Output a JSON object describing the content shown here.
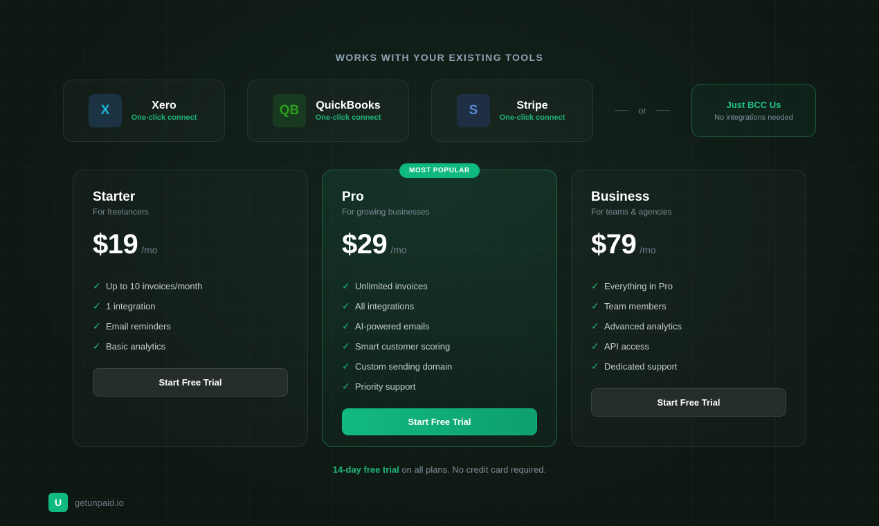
{
  "heading": "WORKS WITH YOUR EXISTING TOOLS",
  "integrations": [
    {
      "name": "Xero",
      "subtitle": "One-click connect",
      "logo_text": "X",
      "icon": "xero-logo-icon",
      "color": "#1ab4d7",
      "bg": "#1b3342"
    },
    {
      "name": "QuickBooks",
      "subtitle": "One-click connect",
      "logo_text": "QB",
      "icon": "quickbooks-logo-icon",
      "color": "#2ca01c",
      "bg": "#173a20"
    },
    {
      "name": "Stripe",
      "subtitle": "One-click connect",
      "logo_text": "S",
      "icon": "stripe-logo-icon",
      "color": "#5a86d6",
      "bg": "#1f2f43"
    }
  ],
  "or_label": "or",
  "bcc": {
    "title": "Just BCC Us",
    "subtitle": "No integrations needed"
  },
  "plans": [
    {
      "name": "Starter",
      "description": "For freelancers",
      "price": "$19",
      "period": "/mo",
      "features": [
        "Up to 10 invoices/month",
        "1 integration",
        "Email reminders",
        "Basic analytics"
      ],
      "cta": "Start Free Trial"
    },
    {
      "name": "Pro",
      "description": "For growing businesses",
      "price": "$29",
      "period": "/mo",
      "badge": "MOST POPULAR",
      "features": [
        "Unlimited invoices",
        "All integrations",
        "AI-powered emails",
        "Smart customer scoring",
        "Custom sending domain",
        "Priority support"
      ],
      "cta": "Start Free Trial"
    },
    {
      "name": "Business",
      "description": "For teams & agencies",
      "price": "$79",
      "period": "/mo",
      "features": [
        "Everything in Pro",
        "Team members",
        "Advanced analytics",
        "API access",
        "Dedicated support"
      ],
      "cta": "Start Free Trial"
    }
  ],
  "check_icon": "✓",
  "footnote": {
    "highlight": "14-day free trial",
    "rest": " on all plans. No credit card required."
  },
  "brand": {
    "logo_text": "U",
    "name": "getunpaid.io"
  },
  "colors": {
    "accent": "#10b981",
    "background": "#0f1a15",
    "text_muted": "#7a8995"
  }
}
